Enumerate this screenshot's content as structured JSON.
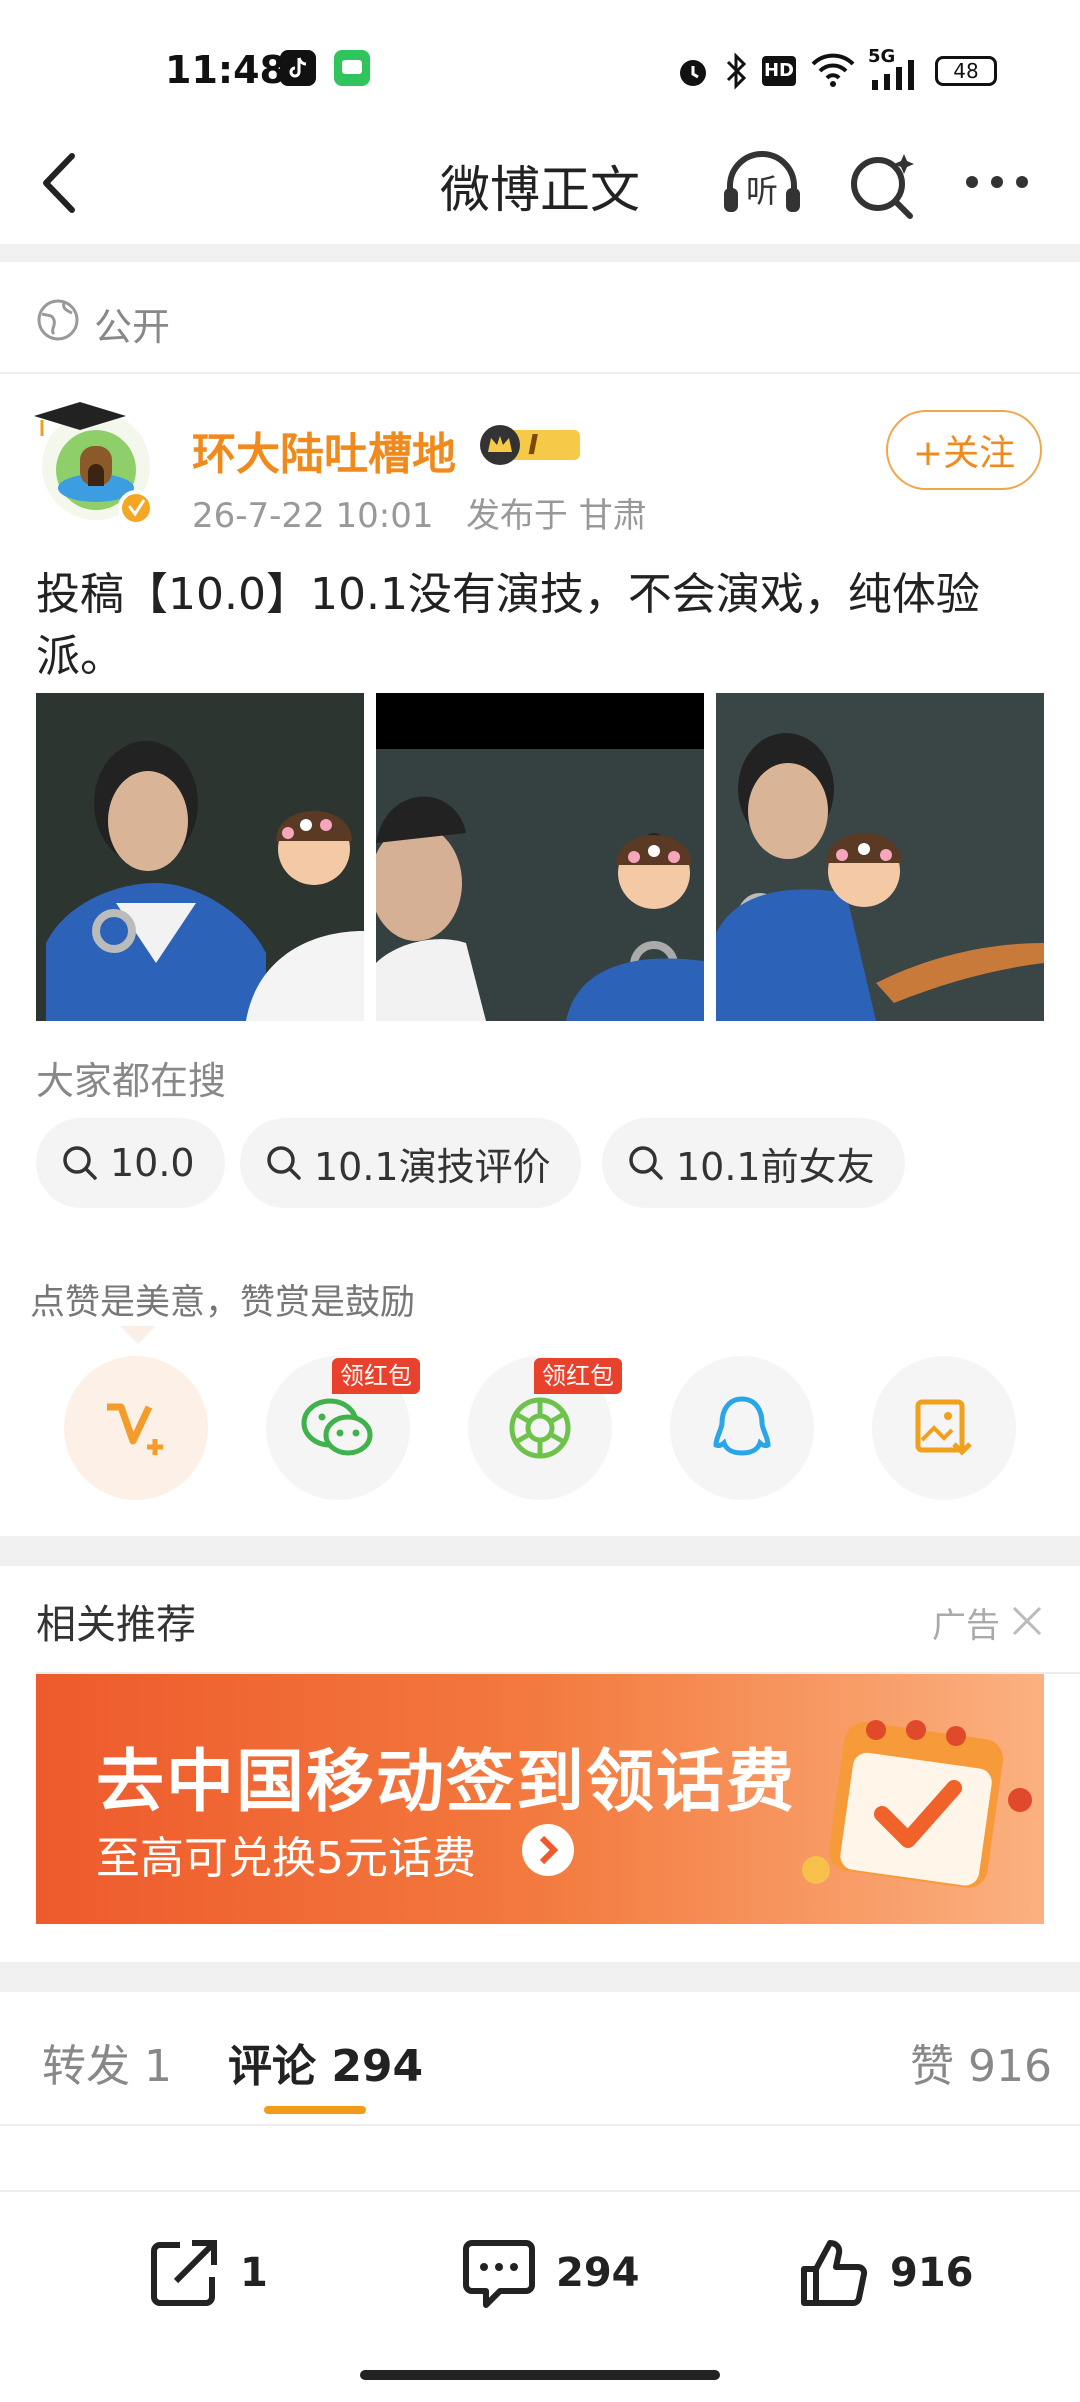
{
  "status_bar": {
    "time": "11:48",
    "battery": "48",
    "network": "5G"
  },
  "nav": {
    "title": "微博正文",
    "listen_label": "听"
  },
  "visibility": "公开",
  "author": {
    "name": "环大陆吐槽地",
    "level": "I",
    "time": "26-7-22 10:01",
    "location": "发布于 甘肃",
    "follow_label": "+关注"
  },
  "post": {
    "text": "投稿【10.0】10.1没有演技，不会演戏，纯体验派。"
  },
  "searches": {
    "title": "大家都在搜",
    "items": [
      "10.0",
      "10.1演技评价",
      "10.1前女友"
    ]
  },
  "reward": {
    "tip": "点赞是美意，赞赏是鼓励",
    "badge_label": "领红包"
  },
  "related": {
    "title": "相关推荐",
    "ad_label": "广告",
    "banner_title": "去中国移动签到领话费",
    "banner_subtitle": "至高可兑换5元话费"
  },
  "tabs": {
    "repost": "转发 1",
    "comment": "评论 294",
    "like": "赞 916"
  },
  "bottom": {
    "repost_count": "1",
    "comment_count": "294",
    "like_count": "916"
  },
  "colors": {
    "accent": "#f08a1d",
    "tab_underline": "#f49a1a",
    "badge": "#e8412c",
    "wechat": "#3fb24b",
    "moments": "#6cc24a",
    "qq": "#2aa5e8"
  }
}
